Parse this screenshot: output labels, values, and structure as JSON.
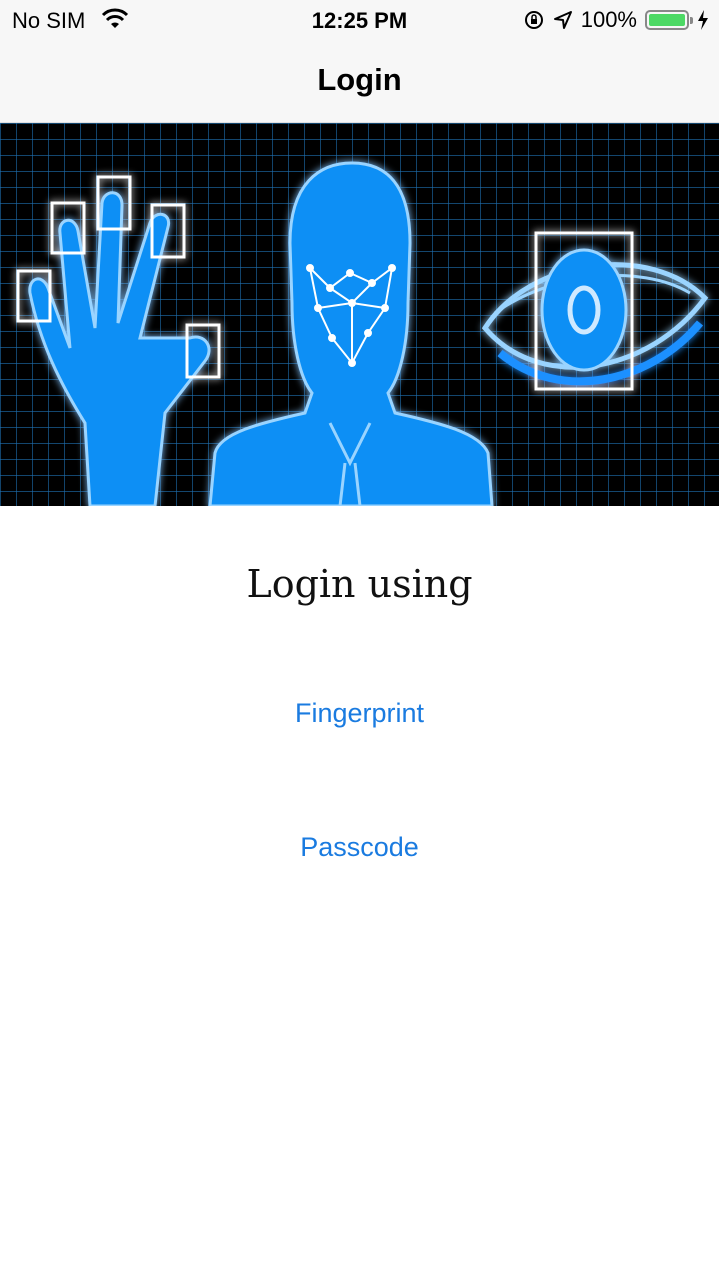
{
  "status": {
    "carrier": "No SIM",
    "time": "12:25 PM",
    "battery_percent": "100%",
    "battery_level": 1.0,
    "icons": [
      "wifi-icon",
      "orientation-lock-icon",
      "location-arrow-icon",
      "battery-icon",
      "charging-bolt-icon"
    ]
  },
  "nav": {
    "title": "Login"
  },
  "hero": {
    "image": "biometrics-illustration",
    "colors": {
      "glow": "#1e90ff",
      "bg": "#000000"
    }
  },
  "main": {
    "heading": "Login using",
    "buttons": {
      "fingerprint": "Fingerprint",
      "passcode": "Passcode"
    }
  },
  "theme": {
    "accent": "#1a7be0",
    "bar_bg": "#f7f7f7"
  }
}
